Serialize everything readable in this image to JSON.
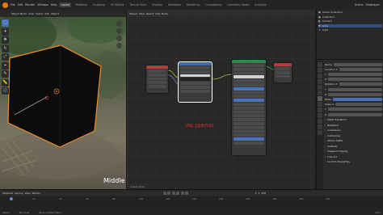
{
  "topbar": {
    "menus": [
      "File",
      "Edit",
      "Render",
      "Window",
      "Help"
    ],
    "workspaces": [
      "Layout",
      "Modeling",
      "Sculpting",
      "UV Editing",
      "Texture Paint",
      "Shading",
      "Animation",
      "Rendering",
      "Compositing",
      "Geometry Nodes",
      "Scripting"
    ],
    "active_workspace": "Layout",
    "scene": "Scene",
    "view_layer": "ViewLayer"
  },
  "viewport": {
    "mode": "Object Mode",
    "view": "View",
    "select": "Select",
    "add": "Add",
    "object": "Object",
    "overlay_label": "Middle"
  },
  "node_editor": {
    "header": [
      "Object",
      "View",
      "Select",
      "Add",
      "Node"
    ],
    "status": "Image Node"
  },
  "annotation": {
    "text": "添加【图像节点】"
  },
  "outliner": {
    "rows": [
      "Scene Collection",
      "Collection",
      "Camera",
      "Cube",
      "Light"
    ]
  },
  "properties": {
    "rows": [
      "Name",
      "Location X",
      "Y",
      "Z",
      "Rotation X",
      "Y",
      "Z",
      "Mode",
      "Scale X",
      "Y",
      "Z"
    ],
    "sections": [
      "Delta Transform",
      "Relations",
      "Collections",
      "Instancing",
      "Motion Paths",
      "Visibility",
      "Viewport Display",
      "Line Art",
      "Custom Properties"
    ]
  },
  "timeline": {
    "controls": [
      "Playback",
      "Keying",
      "View",
      "Marker"
    ],
    "ticks": [
      "0",
      "20",
      "40",
      "60",
      "80",
      "100",
      "120",
      "140",
      "160",
      "180",
      "200",
      "220",
      "240"
    ],
    "current_frame": "1",
    "start": "1",
    "end": "250"
  },
  "statusbar": {
    "left": "Select",
    "middle": "Pan View",
    "right_menu": "Node Context Menu",
    "version": "3.6.0"
  },
  "colors": {
    "accent_blue": "#4772b3",
    "annotation_red": "#e0281e",
    "selection_orange": "#f08c28",
    "node_header_red": "#b63d3d",
    "node_header_green": "#2e8b4a",
    "node_header_blue": "#3b6fa8"
  }
}
